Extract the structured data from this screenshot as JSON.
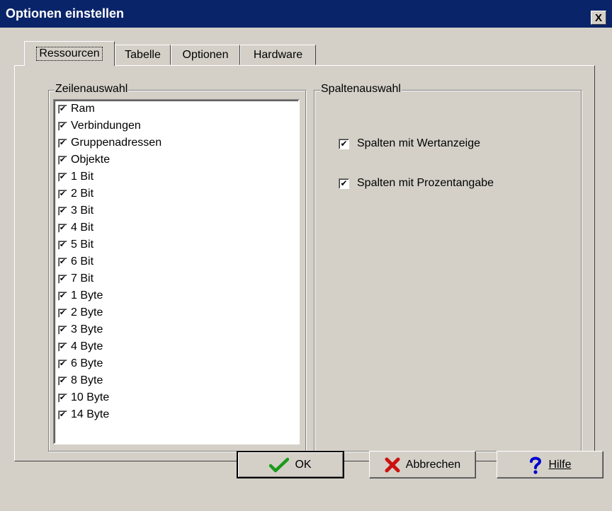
{
  "window": {
    "title": "Optionen einstellen",
    "close_glyph": "X"
  },
  "tabs": [
    {
      "label": "Ressourcen",
      "active": true
    },
    {
      "label": "Tabelle",
      "active": false
    },
    {
      "label": "Optionen",
      "active": false
    },
    {
      "label": "Hardware",
      "active": false
    }
  ],
  "row_selection": {
    "legend": "Zeilenauswahl",
    "items": [
      {
        "label": "Ram",
        "checked": true
      },
      {
        "label": "Verbindungen",
        "checked": true
      },
      {
        "label": "Gruppenadressen",
        "checked": true
      },
      {
        "label": "Objekte",
        "checked": true
      },
      {
        "label": "1 Bit",
        "checked": true
      },
      {
        "label": "2 Bit",
        "checked": true
      },
      {
        "label": "3 Bit",
        "checked": true
      },
      {
        "label": "4 Bit",
        "checked": true
      },
      {
        "label": "5 Bit",
        "checked": true
      },
      {
        "label": "6 Bit",
        "checked": true
      },
      {
        "label": "7 Bit",
        "checked": true
      },
      {
        "label": "1 Byte",
        "checked": true
      },
      {
        "label": "2 Byte",
        "checked": true
      },
      {
        "label": "3 Byte",
        "checked": true
      },
      {
        "label": "4 Byte",
        "checked": true
      },
      {
        "label": "6 Byte",
        "checked": true
      },
      {
        "label": "8 Byte",
        "checked": true
      },
      {
        "label": "10 Byte",
        "checked": true
      },
      {
        "label": "14 Byte",
        "checked": true
      }
    ]
  },
  "column_selection": {
    "legend": "Spaltenauswahl",
    "options": [
      {
        "label": "Spalten mit Wertanzeige",
        "checked": true
      },
      {
        "label": "Spalten mit Prozentangabe",
        "checked": true
      }
    ]
  },
  "buttons": {
    "ok": "OK",
    "cancel": "Abbrechen",
    "help": "Hilfe"
  },
  "colors": {
    "titlebar": "#0a246a",
    "face": "#d4d0c8",
    "ok_icon": "#1a9a1a",
    "cancel_icon": "#cc1111",
    "help_icon": "#0000cc"
  },
  "icons": {
    "ok": "checkmark-icon",
    "cancel": "x-icon",
    "help": "question-mark-icon"
  },
  "check_glyph": "✔"
}
